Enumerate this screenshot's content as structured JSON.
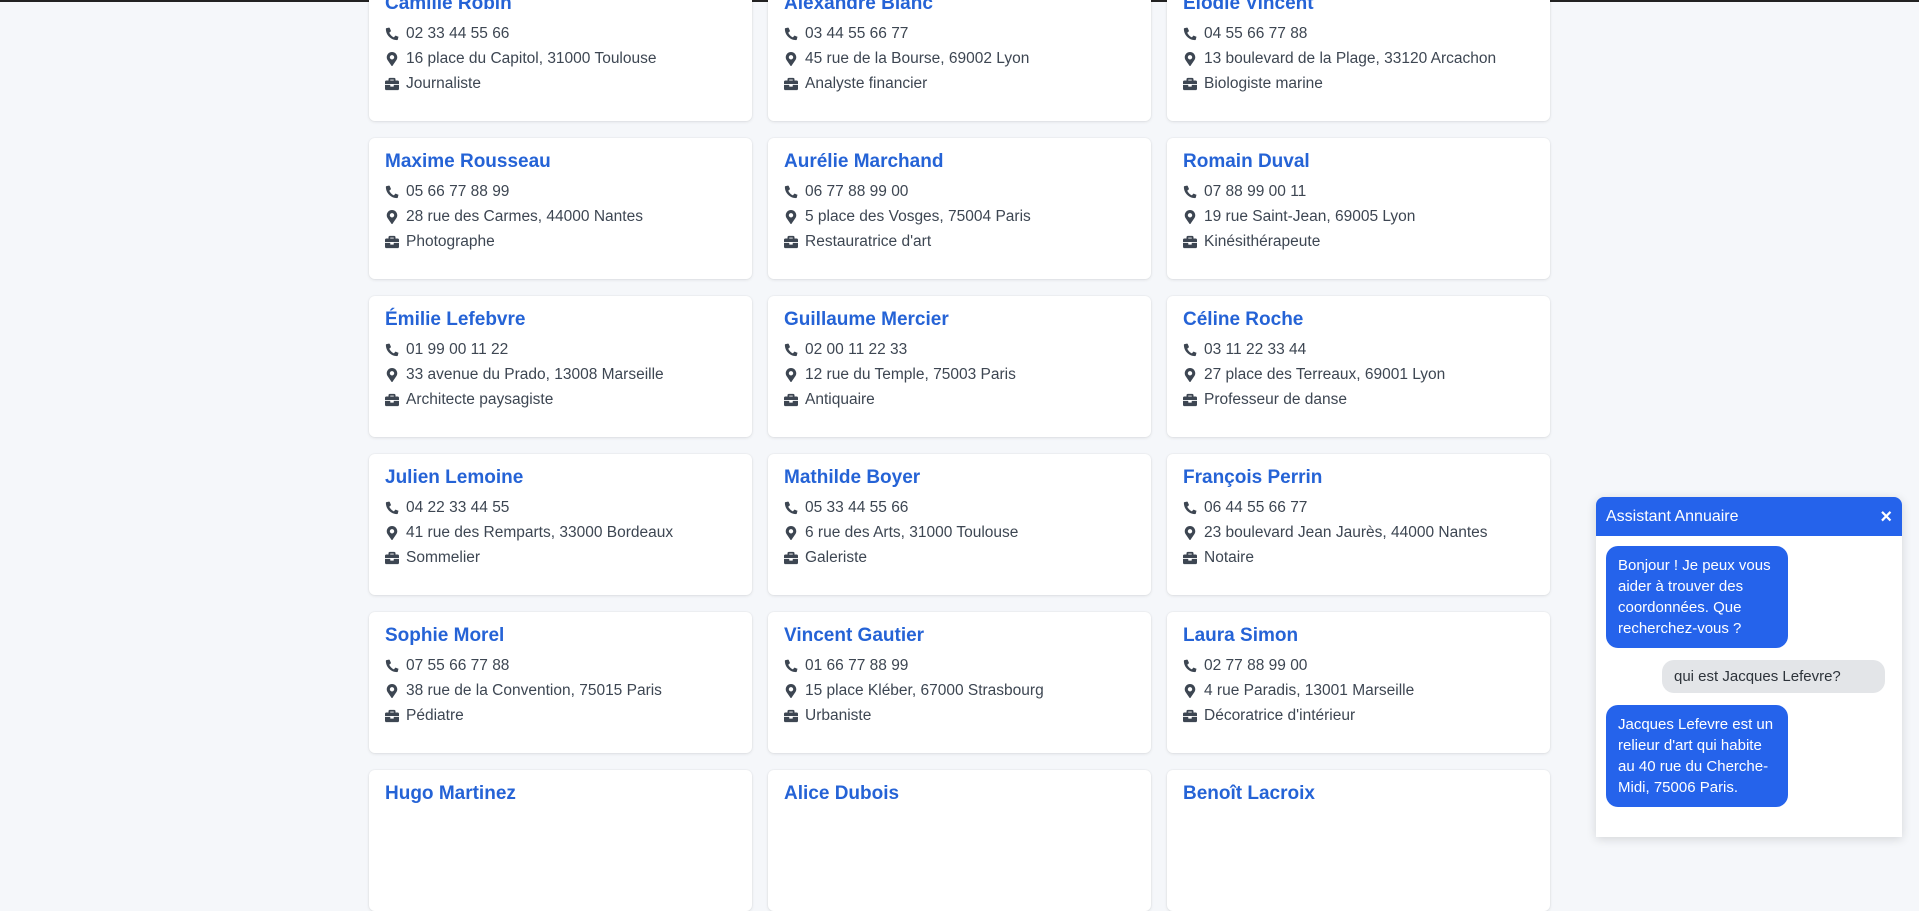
{
  "contacts": [
    {
      "name": "Camille Robin",
      "phone": "02 33 44 55 66",
      "address": "16 place du Capitol, 31000 Toulouse",
      "job": "Journaliste"
    },
    {
      "name": "Alexandre Blanc",
      "phone": "03 44 55 66 77",
      "address": "45 rue de la Bourse, 69002 Lyon",
      "job": "Analyste financier"
    },
    {
      "name": "Élodie Vincent",
      "phone": "04 55 66 77 88",
      "address": "13 boulevard de la Plage, 33120 Arcachon",
      "job": "Biologiste marine"
    },
    {
      "name": "Maxime Rousseau",
      "phone": "05 66 77 88 99",
      "address": "28 rue des Carmes, 44000 Nantes",
      "job": "Photographe"
    },
    {
      "name": "Aurélie Marchand",
      "phone": "06 77 88 99 00",
      "address": "5 place des Vosges, 75004 Paris",
      "job": "Restauratrice d'art"
    },
    {
      "name": "Romain Duval",
      "phone": "07 88 99 00 11",
      "address": "19 rue Saint-Jean, 69005 Lyon",
      "job": "Kinésithérapeute"
    },
    {
      "name": "Émilie Lefebvre",
      "phone": "01 99 00 11 22",
      "address": "33 avenue du Prado, 13008 Marseille",
      "job": "Architecte paysagiste"
    },
    {
      "name": "Guillaume Mercier",
      "phone": "02 00 11 22 33",
      "address": "12 rue du Temple, 75003 Paris",
      "job": "Antiquaire"
    },
    {
      "name": "Céline Roche",
      "phone": "03 11 22 33 44",
      "address": "27 place des Terreaux, 69001 Lyon",
      "job": "Professeur de danse"
    },
    {
      "name": "Julien Lemoine",
      "phone": "04 22 33 44 55",
      "address": "41 rue des Remparts, 33000 Bordeaux",
      "job": "Sommelier"
    },
    {
      "name": "Mathilde Boyer",
      "phone": "05 33 44 55 66",
      "address": "6 rue des Arts, 31000 Toulouse",
      "job": "Galeriste"
    },
    {
      "name": "François Perrin",
      "phone": "06 44 55 66 77",
      "address": "23 boulevard Jean Jaurès, 44000 Nantes",
      "job": "Notaire"
    },
    {
      "name": "Sophie Morel",
      "phone": "07 55 66 77 88",
      "address": "38 rue de la Convention, 75015 Paris",
      "job": "Pédiatre"
    },
    {
      "name": "Vincent Gautier",
      "phone": "01 66 77 88 99",
      "address": "15 place Kléber, 67000 Strasbourg",
      "job": "Urbaniste"
    },
    {
      "name": "Laura Simon",
      "phone": "02 77 88 99 00",
      "address": "4 rue Paradis, 13001 Marseille",
      "job": "Décoratrice d'intérieur"
    },
    {
      "name": "Hugo Martinez",
      "phone": "",
      "address": "",
      "job": ""
    },
    {
      "name": "Alice Dubois",
      "phone": "",
      "address": "",
      "job": ""
    },
    {
      "name": "Benoît Lacroix",
      "phone": "",
      "address": "",
      "job": ""
    }
  ],
  "chat": {
    "title": "Assistant Annuaire",
    "close_label": "×",
    "messages": [
      {
        "from": "bot",
        "text": "Bonjour ! Je peux vous aider à trouver des coordonnées. Que recherchez-vous ?"
      },
      {
        "from": "user",
        "text": "qui est Jacques Lefevre?"
      },
      {
        "from": "bot",
        "text": "Jacques Lefevre est un relieur d'art qui habite au 40 rue du Cherche-Midi, 75006 Paris."
      }
    ]
  },
  "icons": {
    "phone": "phone-icon",
    "address": "map-marker-icon",
    "job": "briefcase-icon"
  },
  "colors": {
    "accent": "#2563eb",
    "name": "#2563d6",
    "background": "#f5f7fa"
  }
}
